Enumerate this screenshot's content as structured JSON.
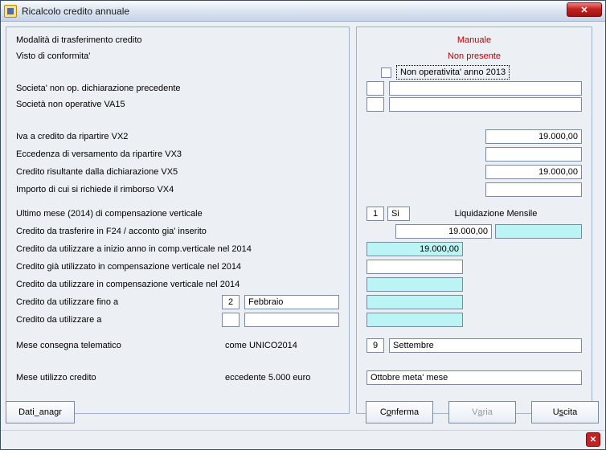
{
  "window": {
    "title": "Ricalcolo credito annuale"
  },
  "left": {
    "r1": "Modalità di trasferimento credito",
    "r2": "Visto di conformita'",
    "r3": "Societa' non op. dichiarazione precedente",
    "r4": "Società non operative VA15",
    "r5": "Iva a credito da ripartire     VX2",
    "r6": "Eccedenza di versamento da ripartire      VX3",
    "r7": "Credito risultante dalla dichiarazione      VX5",
    "r8": "Importo di cui si richiede il rimborso      VX4",
    "r9": "Ultimo mese (2014) di compensazione verticale",
    "r10": "Credito da trasferire in F24 / acconto gia' inserito",
    "r11": "Credito da utilizzare a inizio anno in comp.verticale nel 2014",
    "r12": "Credito già utilizzato in compensazione verticale nel 2014",
    "r13": "Credito da utilizzare in compensazione verticale nel 2014",
    "r14_label": "Credito da utilizzare fino a",
    "r14_num": "2",
    "r14_month": "Febbraio",
    "r15_label": "Credito da utilizzare a",
    "r16_label": "Mese consegna telematico",
    "r16_note": "come UNICO2014",
    "r17_label": "Mese utilizzo credito",
    "r17_note": "eccedente  5.000 euro"
  },
  "right": {
    "mode": "Manuale",
    "visto": "Non presente",
    "nonop_label": "Non operativita' anno 2013",
    "nonop_prev_code": "",
    "nonop_prev_desc": "",
    "va15_code": "",
    "va15_desc": "",
    "vx2": "19.000,00",
    "vx3": "",
    "vx5": "19.000,00",
    "vx4": "",
    "last_month_num": "1",
    "last_month_si": "Si",
    "liquidazione": "Liquidazione Mensile",
    "f24": "19.000,00",
    "f24_extra": "",
    "inizio_anno": "19.000,00",
    "gia_util": "",
    "da_util": "",
    "fino_a": "",
    "fino_a2": "",
    "consegna_num": "9",
    "consegna_month": "Settembre",
    "utilizzo": "Ottobre meta' mese"
  },
  "buttons": {
    "dati": "Dati_anagr",
    "conferma_pre": "C",
    "conferma_ul": "o",
    "conferma_post": "nferma",
    "varia_pre": "V",
    "varia_ul": "a",
    "varia_post": "ria",
    "uscita_pre": "U",
    "uscita_ul": "s",
    "uscita_post": "cita"
  }
}
